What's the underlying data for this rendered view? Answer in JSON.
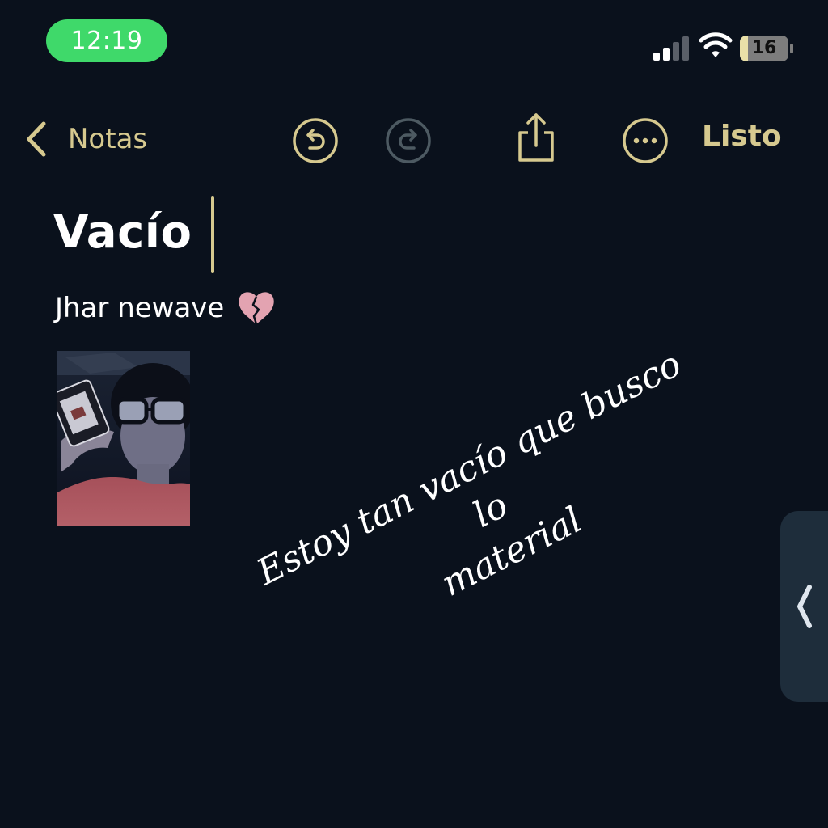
{
  "status_bar": {
    "time": "12:19",
    "battery_level": "16",
    "battery_fraction": 0.16,
    "signal_bars_active": 2,
    "icons": [
      "signal-icon",
      "wifi-icon",
      "battery-icon"
    ]
  },
  "nav": {
    "back_label": "Notas",
    "done_label": "Listo",
    "icons": [
      "chevron-left-icon",
      "undo-icon",
      "redo-icon",
      "share-icon",
      "more-icon"
    ]
  },
  "note": {
    "title": "Vacío",
    "subtitle": "Jhar newave",
    "subtitle_emoji_icon": "broken-heart-icon",
    "photo_icon": "photo-thumbnail"
  },
  "caption": {
    "line1": "Estoy tan vacío que busco lo",
    "line2": "material"
  },
  "colors": {
    "background": "#0a111c",
    "accent": "#d6c98f",
    "time_pill": "#3fd96a",
    "text": "#ffffff",
    "side_handle": "#1e2d3b"
  }
}
